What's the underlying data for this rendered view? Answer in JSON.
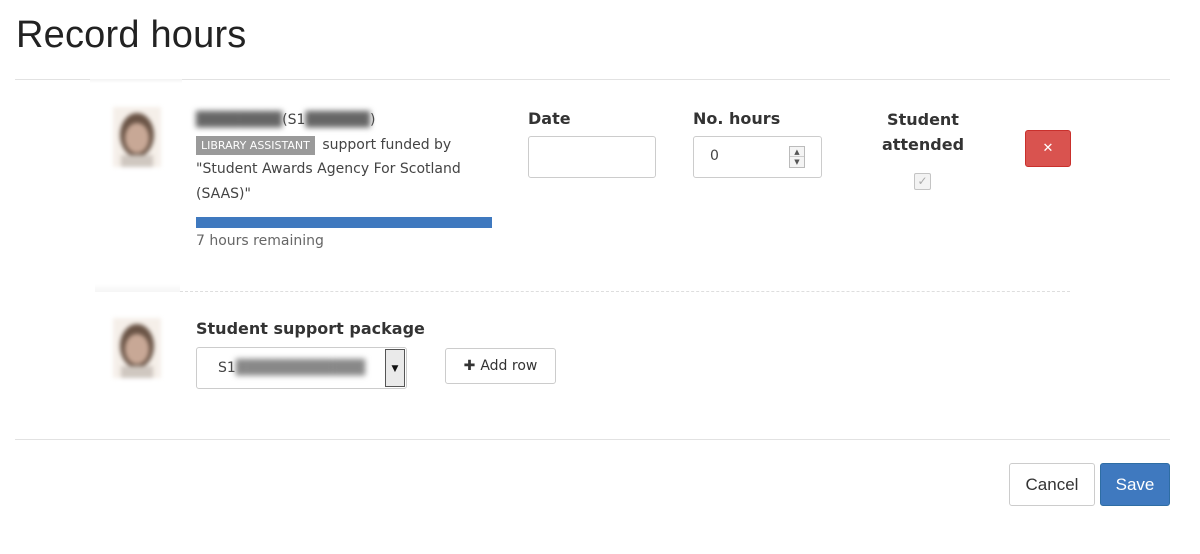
{
  "page": {
    "title": "Record hours"
  },
  "record": {
    "student_name_redacted": "████████",
    "student_id_prefix": "(S1",
    "student_id_redacted": "██████",
    "student_id_suffix": ")",
    "badge": "LIBRARY ASSISTANT",
    "funded_text": "support funded by \"Student Awards Agency For Scotland (SAAS)\"",
    "remaining_text": "7 hours remaining",
    "progress_fraction": 1.0
  },
  "columns": {
    "date_label": "Date",
    "hours_label": "No. hours",
    "attended_label": "Student attended"
  },
  "inputs": {
    "date_value": "",
    "hours_value": "0",
    "attended_checked": true
  },
  "icons": {
    "remove": "close-icon",
    "spinner_up": "caret-up-icon",
    "spinner_down": "caret-down-icon",
    "select_arrow": "caret-down-icon",
    "add": "plus-icon",
    "checkbox": "check-icon"
  },
  "colors": {
    "primary": "#3f79bf",
    "danger": "#d9534f",
    "badge": "#9a9a9a"
  },
  "package": {
    "label": "Student support package",
    "select_prefix": "S1",
    "select_redacted": "████████████",
    "add_row_label": "Add row"
  },
  "footer": {
    "cancel_label": "Cancel",
    "save_label": "Save"
  }
}
